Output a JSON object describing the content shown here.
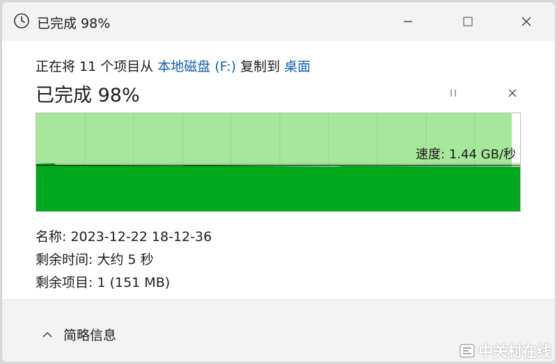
{
  "window": {
    "title": "已完成 98%",
    "icons": [
      "clock-icon",
      "minimize-icon",
      "maximize-icon",
      "close-icon"
    ]
  },
  "copy": {
    "prefix": "正在将 11 个项目从 ",
    "source": "本地磁盘 (F:)",
    "middle": " 复制到 ",
    "destination": "桌面"
  },
  "progress": {
    "title": "已完成 98%",
    "percent": 98,
    "speed_label": "速度: 1.44 GB/秒"
  },
  "details": [
    {
      "label": "名称: ",
      "value": "2023-12-22 18-12-36"
    },
    {
      "label": "剩余时间: ",
      "value": "大约 5 秒"
    },
    {
      "label": "剩余项目: ",
      "value": "1 (151 MB)"
    }
  ],
  "footer": {
    "toggle_label": "简略信息"
  },
  "watermark": {
    "text": "中关村在线"
  },
  "colors": {
    "graph_fill": "#00a81c",
    "graph_background": "#a6e79b",
    "link": "#0f5fb0",
    "speed_line": "#111111"
  }
}
